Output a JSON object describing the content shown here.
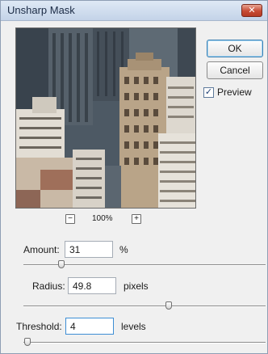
{
  "window": {
    "title": "Unsharp Mask",
    "close_glyph": "✕"
  },
  "buttons": {
    "ok": "OK",
    "cancel": "Cancel"
  },
  "preview": {
    "checkbox_label": "Preview",
    "checked": true,
    "check_glyph": "✓"
  },
  "zoom": {
    "minus": "−",
    "plus": "+",
    "level": "100%"
  },
  "fields": {
    "amount": {
      "label": "Amount:",
      "value": "31",
      "unit": "%"
    },
    "radius": {
      "label": "Radius:",
      "value": "49.8",
      "unit": "pixels"
    },
    "threshold": {
      "label": "Threshold:",
      "value": "4",
      "unit": "levels"
    }
  },
  "sliders": {
    "amount_fraction": 0.155,
    "radius_fraction": 0.6,
    "threshold_fraction": 0.016
  }
}
